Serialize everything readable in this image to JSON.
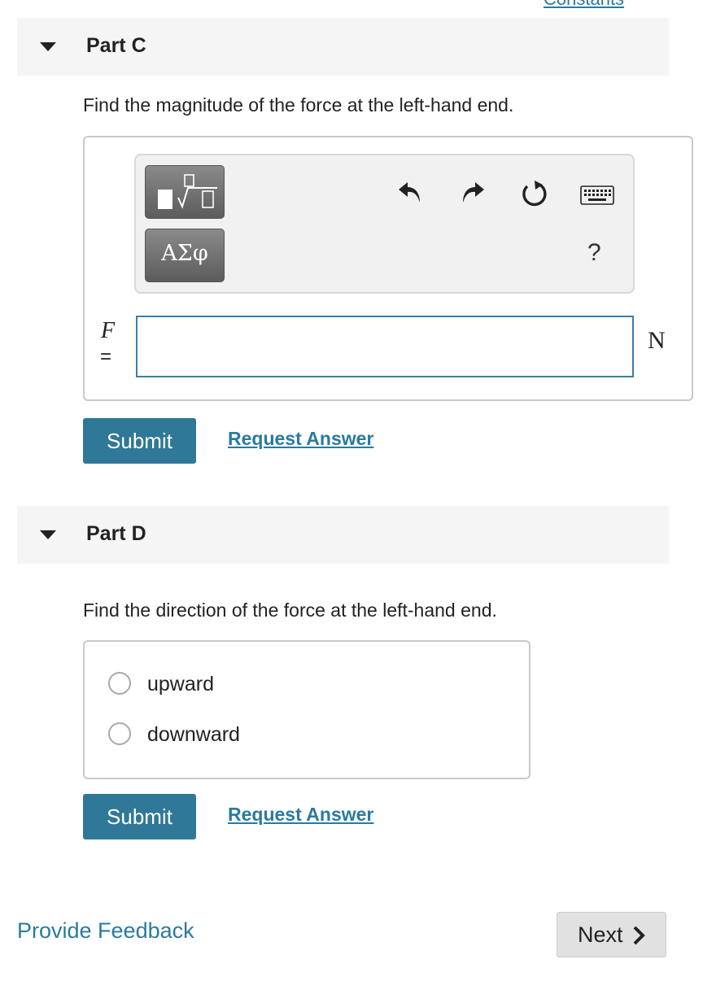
{
  "header": {
    "top_link_label": "Constants"
  },
  "part_c": {
    "title": "Part C",
    "question": "Find the magnitude of the force at the left-hand end.",
    "toolbar": {
      "templates_icon": "fraction-sqrt-icon",
      "greek_label": "ΑΣφ",
      "undo_icon": "undo-icon",
      "redo_icon": "redo-icon",
      "reset_icon": "reset-icon",
      "keyboard_icon": "keyboard-icon",
      "help_label": "?"
    },
    "variable": "F",
    "equals": "=",
    "answer_value": "",
    "unit": "N",
    "submit_label": "Submit",
    "request_answer_label": "Request Answer"
  },
  "part_d": {
    "title": "Part D",
    "question": "Find the direction of the force at the left-hand end.",
    "choices": [
      {
        "label": "upward",
        "selected": false
      },
      {
        "label": "downward",
        "selected": false
      }
    ],
    "submit_label": "Submit",
    "request_answer_label": "Request Answer"
  },
  "footer": {
    "feedback_label": "Provide Feedback",
    "next_label": "Next"
  },
  "colors": {
    "accent": "#2f7897",
    "link": "#2a7aa0",
    "header_bg": "#f5f5f5",
    "input_border": "#3b7fa3"
  }
}
